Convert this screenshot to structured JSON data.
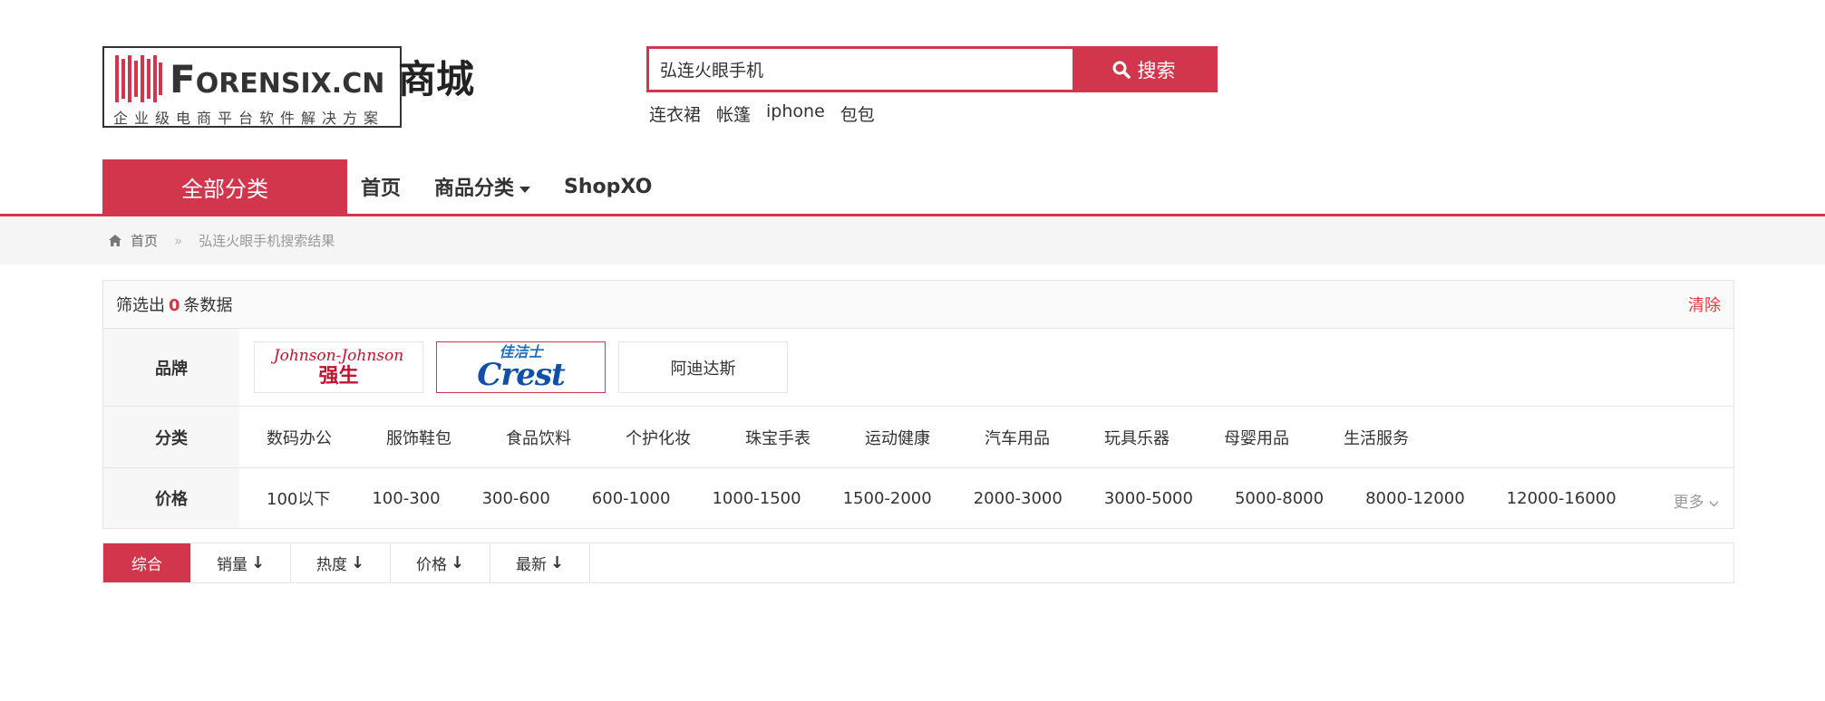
{
  "logo": {
    "brand_first": "F",
    "brand_rest": "ORENSIX.CN",
    "brand_cn": "商城",
    "slogan": "企业级电商平台软件解决方案"
  },
  "search": {
    "value": "弘连火眼手机",
    "button_label": "搜索",
    "hot_words": [
      "连衣裙",
      "帐篷",
      "iphone",
      "包包"
    ]
  },
  "nav": {
    "all_categories": "全部分类",
    "items": [
      "首页",
      "商品分类",
      "ShopXO"
    ]
  },
  "breadcrumb": {
    "home": "首页",
    "separator": "»",
    "current": "弘连火眼手机搜索结果"
  },
  "filter": {
    "result_prefix": "筛选出",
    "result_count": "0",
    "result_suffix": "条数据",
    "clear": "清除",
    "brand_label": "品牌",
    "brands": [
      {
        "script": "Johnson-Johnson",
        "cn": "强生"
      },
      {
        "cn": "佳洁士",
        "en": "Crest"
      },
      {
        "name": "阿迪达斯"
      }
    ],
    "category_label": "分类",
    "categories": [
      "数码办公",
      "服饰鞋包",
      "食品饮料",
      "个护化妆",
      "珠宝手表",
      "运动健康",
      "汽车用品",
      "玩具乐器",
      "母婴用品",
      "生活服务"
    ],
    "price_label": "价格",
    "prices": [
      "100以下",
      "100-300",
      "300-600",
      "600-1000",
      "1000-1500",
      "1500-2000",
      "2000-3000",
      "3000-5000",
      "5000-8000",
      "8000-12000",
      "12000-16000"
    ],
    "more": "更多"
  },
  "sort": {
    "items": [
      "综合",
      "销量",
      "热度",
      "价格",
      "最新"
    ],
    "arrow": "↓"
  },
  "colors": {
    "accent": "#d2364c",
    "clear_text": "#e4393c"
  }
}
